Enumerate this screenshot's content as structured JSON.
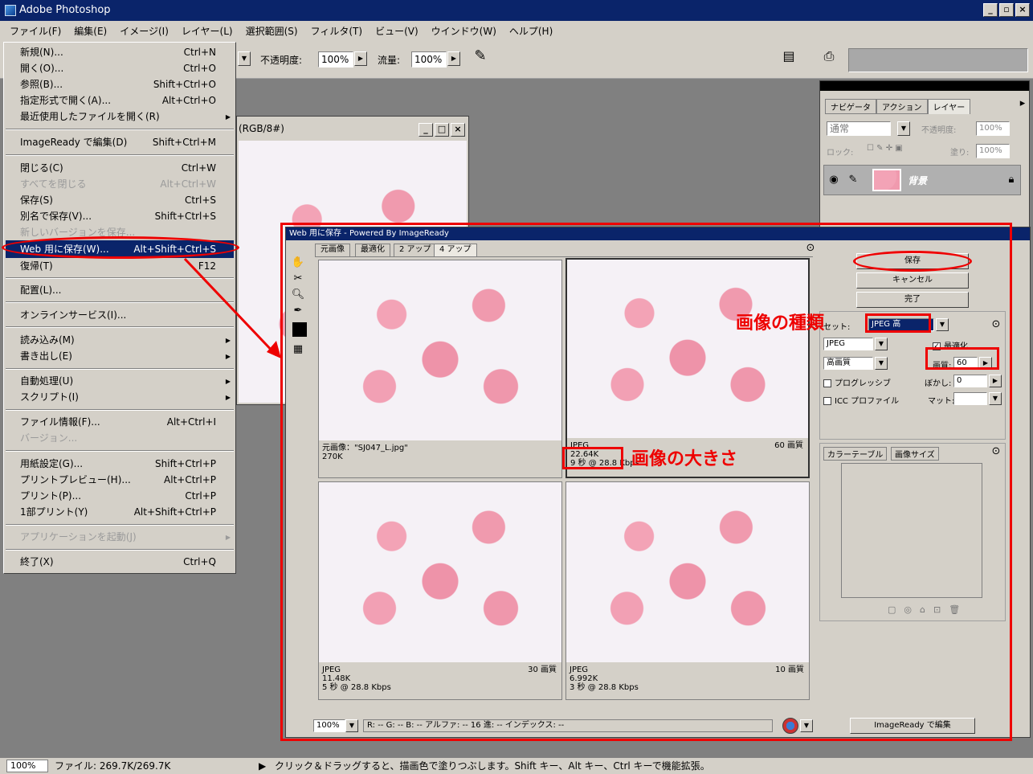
{
  "window": {
    "title": "Adobe Photoshop",
    "controls": [
      "_",
      "▫",
      "×"
    ]
  },
  "menubar": {
    "items": [
      "ファイル(F)",
      "編集(E)",
      "イメージ(I)",
      "レイヤー(L)",
      "選択範囲(S)",
      "フィルタ(T)",
      "ビュー(V)",
      "ウインドウ(W)",
      "ヘルプ(H)"
    ]
  },
  "options": {
    "opacity_label": "不透明度:",
    "opacity_value": "100%",
    "flow_label": "流量:",
    "flow_value": "100%"
  },
  "file_menu": {
    "items": [
      {
        "label": "新規(N)...",
        "shortcut": "Ctrl+N"
      },
      {
        "label": "開く(O)...",
        "shortcut": "Ctrl+O"
      },
      {
        "label": "参照(B)...",
        "shortcut": "Shift+Ctrl+O"
      },
      {
        "label": "指定形式で開く(A)...",
        "shortcut": "Alt+Ctrl+O"
      },
      {
        "label": "最近使用したファイルを開く(R)",
        "shortcut": ""
      },
      {
        "label": "ImageReady で編集(D)",
        "shortcut": "Shift+Ctrl+M"
      },
      {
        "label": "閉じる(C)",
        "shortcut": "Ctrl+W"
      },
      {
        "label": "すべてを閉じる",
        "shortcut": "Alt+Ctrl+W"
      },
      {
        "label": "保存(S)",
        "shortcut": "Ctrl+S"
      },
      {
        "label": "別名で保存(V)...",
        "shortcut": "Shift+Ctrl+S"
      },
      {
        "label": "新しいバージョンを保存...",
        "shortcut": ""
      },
      {
        "label": "Web 用に保存(W)...",
        "shortcut": "Alt+Shift+Ctrl+S"
      },
      {
        "label": "復帰(T)",
        "shortcut": "F12"
      },
      {
        "label": "配置(L)...",
        "shortcut": ""
      },
      {
        "label": "オンラインサービス(I)...",
        "shortcut": ""
      },
      {
        "label": "読み込み(M)",
        "shortcut": ""
      },
      {
        "label": "書き出し(E)",
        "shortcut": ""
      },
      {
        "label": "自動処理(U)",
        "shortcut": ""
      },
      {
        "label": "スクリプト(I)",
        "shortcut": ""
      },
      {
        "label": "ファイル情報(F)...",
        "shortcut": "Alt+Ctrl+I"
      },
      {
        "label": "バージョン...",
        "shortcut": ""
      },
      {
        "label": "用紙設定(G)...",
        "shortcut": "Shift+Ctrl+P"
      },
      {
        "label": "プリントプレビュー(H)...",
        "shortcut": "Alt+Ctrl+P"
      },
      {
        "label": "プリント(P)...",
        "shortcut": "Ctrl+P"
      },
      {
        "label": "1部プリント(Y)",
        "shortcut": "Alt+Shift+Ctrl+P"
      },
      {
        "label": "アプリケーションを起動(J)",
        "shortcut": ""
      },
      {
        "label": "終了(X)",
        "shortcut": "Ctrl+Q"
      }
    ]
  },
  "document": {
    "title": "(RGB/8#)"
  },
  "palette": {
    "tabs": [
      "ナビゲータ",
      "アクション",
      "レイヤー"
    ],
    "blend_mode": "通常",
    "opacity_label": "不透明度:",
    "opacity_value": "100%",
    "lock_label": "ロック:",
    "fill_label": "塗り:",
    "fill_value": "100%",
    "layer_name": "背景"
  },
  "save_for_web": {
    "title": "Web 用に保存 - Powered By ImageReady",
    "tabs": [
      "元画像",
      "最適化",
      "2 アップ",
      "4 アップ"
    ],
    "panes": [
      {
        "line1": "元画像：\"SJ047_L.jpg\"",
        "line2": "270K",
        "line3": "",
        "quality": ""
      },
      {
        "line1": "JPEG",
        "line2": "22.64K",
        "line3": "9 秒 @ 28.8 Kbps",
        "quality": "60 画質"
      },
      {
        "line1": "JPEG",
        "line2": "11.48K",
        "line3": "5 秒 @ 28.8 Kbps",
        "quality": "30 画質"
      },
      {
        "line1": "JPEG",
        "line2": "6.992K",
        "line3": "3 秒 @ 28.8 Kbps",
        "quality": "10 画質"
      }
    ],
    "buttons": {
      "save": "保存",
      "cancel": "キャンセル",
      "done": "完了",
      "imageready": "ImageReady で編集"
    },
    "settings": {
      "preset_label": "セット:",
      "preset_value": "JPEG 高",
      "format": "JPEG",
      "optimize_label": "最適化",
      "quality_preset": "高画質",
      "quality_label": "画質:",
      "quality_value": "60",
      "progressive_label": "プログレッシブ",
      "blur_label": "ぼかし:",
      "blur_value": "0",
      "icc_label": "ICC プロファイル",
      "matte_label": "マット:"
    },
    "lower_tabs": [
      "カラーテーブル",
      "画像サイズ"
    ],
    "bottom": {
      "zoom": "100%",
      "readout": "R: --  G: --  B: --  アルファ: --  16 進:      -- インデックス:  --"
    }
  },
  "annotations": {
    "image_type": "画像の種類",
    "image_size": "画像の大きさ"
  },
  "statusbar": {
    "zoom": "100%",
    "file_info": "ファイル: 269.7K/269.7K",
    "hint": "クリック＆ドラッグすると、描画色で塗りつぶします。Shift キー、Alt キー、Ctrl キーで機能拡張。"
  }
}
